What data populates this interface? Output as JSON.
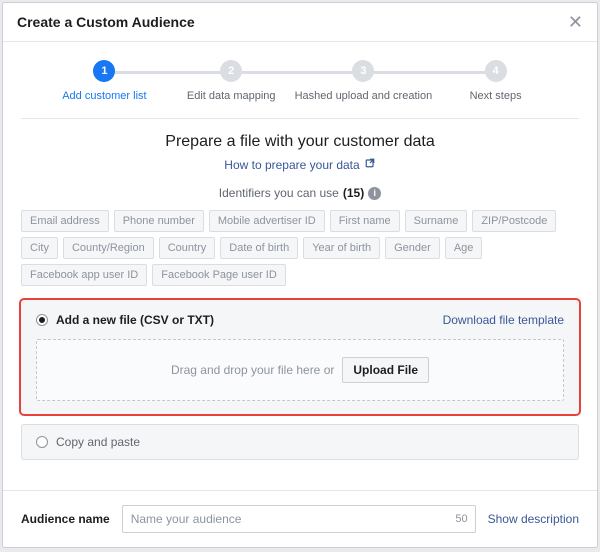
{
  "header": {
    "title": "Create a Custom Audience"
  },
  "stepper": {
    "steps": [
      {
        "num": "1",
        "label": "Add customer list",
        "active": true
      },
      {
        "num": "2",
        "label": "Edit data mapping",
        "active": false
      },
      {
        "num": "3",
        "label": "Hashed upload and creation",
        "active": false
      },
      {
        "num": "4",
        "label": "Next steps",
        "active": false
      }
    ]
  },
  "prepare": {
    "title": "Prepare a file with your customer data",
    "link": "How to prepare your data",
    "identifiers_label": "Identifiers you can use",
    "identifiers_count": "(15)"
  },
  "identifiers": [
    "Email address",
    "Phone number",
    "Mobile advertiser ID",
    "First name",
    "Surname",
    "ZIP/Postcode",
    "City",
    "County/Region",
    "Country",
    "Date of birth",
    "Year of birth",
    "Gender",
    "Age",
    "Facebook app user ID",
    "Facebook Page user ID"
  ],
  "upload": {
    "option_add_file": "Add a new file (CSV or TXT)",
    "download_template": "Download file template",
    "drop_hint": "Drag and drop your file here or",
    "upload_button": "Upload File",
    "option_copy_paste": "Copy and paste"
  },
  "footer": {
    "label": "Audience name",
    "placeholder": "Name your audience",
    "char_limit": "50",
    "show_description": "Show description"
  }
}
